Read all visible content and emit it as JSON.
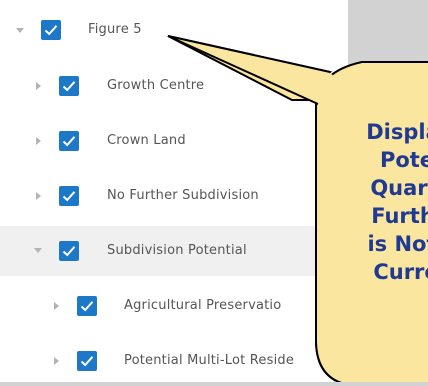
{
  "tree": {
    "items": [
      {
        "label": "Figure 5",
        "expanded": true,
        "checked": true
      },
      {
        "label": "Growth Centre",
        "expanded": false,
        "checked": true
      },
      {
        "label": "Crown Land",
        "expanded": false,
        "checked": true
      },
      {
        "label": "No Further Subdivision",
        "expanded": false,
        "checked": true
      },
      {
        "label": "Subdivision Potential",
        "expanded": true,
        "checked": true
      },
      {
        "label": "Agricultural Preservatio",
        "expanded": false,
        "checked": true
      },
      {
        "label": "Potential Multi-Lot Reside",
        "expanded": false,
        "checked": true
      }
    ]
  },
  "callout": {
    "lines": [
      "Displa",
      "Pote",
      "Quart",
      "Furth",
      "is Not",
      "Curre"
    ]
  },
  "colors": {
    "checkbox": "#1e78c8",
    "callout_fill": "#fbe6a0",
    "callout_text": "#1f3a93",
    "highlight_row": "#f0f0f0"
  }
}
